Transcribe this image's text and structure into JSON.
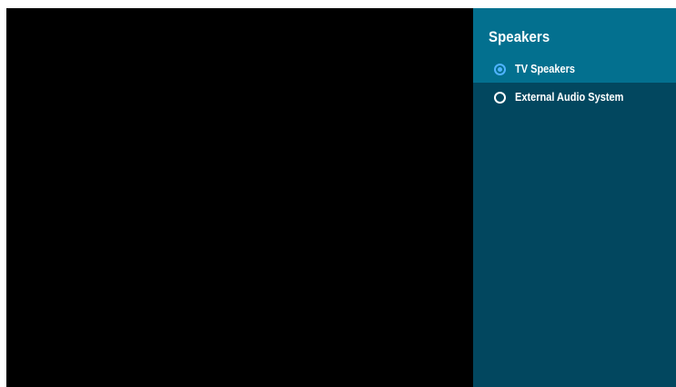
{
  "panel": {
    "title": "Speakers",
    "options": [
      {
        "label": "TV Speakers",
        "selected": true
      },
      {
        "label": "External Audio System",
        "selected": false
      }
    ]
  },
  "colors": {
    "header_bg": "#03708f",
    "panel_bg": "#02475f",
    "radio_selected": "#4fb3ff",
    "screen_bg": "#000000"
  }
}
